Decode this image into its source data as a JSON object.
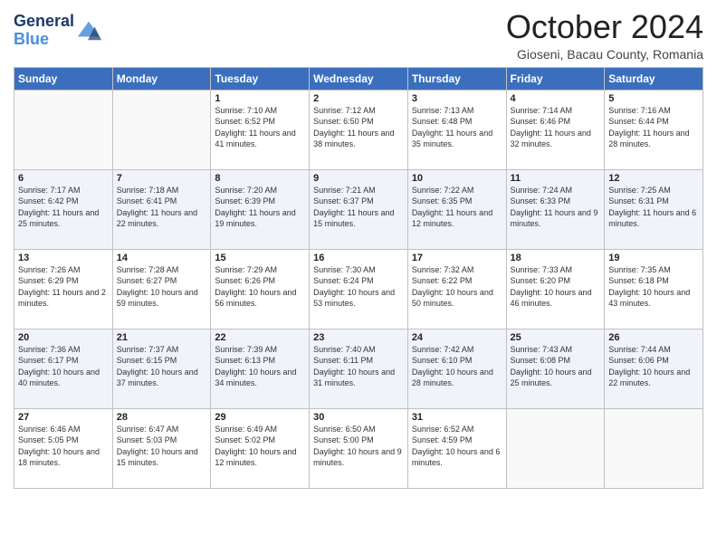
{
  "header": {
    "logo_line1": "General",
    "logo_line2": "Blue",
    "month": "October 2024",
    "location": "Gioseni, Bacau County, Romania"
  },
  "days_of_week": [
    "Sunday",
    "Monday",
    "Tuesday",
    "Wednesday",
    "Thursday",
    "Friday",
    "Saturday"
  ],
  "weeks": [
    [
      {
        "day": "",
        "info": ""
      },
      {
        "day": "",
        "info": ""
      },
      {
        "day": "1",
        "info": "Sunrise: 7:10 AM\nSunset: 6:52 PM\nDaylight: 11 hours and 41 minutes."
      },
      {
        "day": "2",
        "info": "Sunrise: 7:12 AM\nSunset: 6:50 PM\nDaylight: 11 hours and 38 minutes."
      },
      {
        "day": "3",
        "info": "Sunrise: 7:13 AM\nSunset: 6:48 PM\nDaylight: 11 hours and 35 minutes."
      },
      {
        "day": "4",
        "info": "Sunrise: 7:14 AM\nSunset: 6:46 PM\nDaylight: 11 hours and 32 minutes."
      },
      {
        "day": "5",
        "info": "Sunrise: 7:16 AM\nSunset: 6:44 PM\nDaylight: 11 hours and 28 minutes."
      }
    ],
    [
      {
        "day": "6",
        "info": "Sunrise: 7:17 AM\nSunset: 6:42 PM\nDaylight: 11 hours and 25 minutes."
      },
      {
        "day": "7",
        "info": "Sunrise: 7:18 AM\nSunset: 6:41 PM\nDaylight: 11 hours and 22 minutes."
      },
      {
        "day": "8",
        "info": "Sunrise: 7:20 AM\nSunset: 6:39 PM\nDaylight: 11 hours and 19 minutes."
      },
      {
        "day": "9",
        "info": "Sunrise: 7:21 AM\nSunset: 6:37 PM\nDaylight: 11 hours and 15 minutes."
      },
      {
        "day": "10",
        "info": "Sunrise: 7:22 AM\nSunset: 6:35 PM\nDaylight: 11 hours and 12 minutes."
      },
      {
        "day": "11",
        "info": "Sunrise: 7:24 AM\nSunset: 6:33 PM\nDaylight: 11 hours and 9 minutes."
      },
      {
        "day": "12",
        "info": "Sunrise: 7:25 AM\nSunset: 6:31 PM\nDaylight: 11 hours and 6 minutes."
      }
    ],
    [
      {
        "day": "13",
        "info": "Sunrise: 7:26 AM\nSunset: 6:29 PM\nDaylight: 11 hours and 2 minutes."
      },
      {
        "day": "14",
        "info": "Sunrise: 7:28 AM\nSunset: 6:27 PM\nDaylight: 10 hours and 59 minutes."
      },
      {
        "day": "15",
        "info": "Sunrise: 7:29 AM\nSunset: 6:26 PM\nDaylight: 10 hours and 56 minutes."
      },
      {
        "day": "16",
        "info": "Sunrise: 7:30 AM\nSunset: 6:24 PM\nDaylight: 10 hours and 53 minutes."
      },
      {
        "day": "17",
        "info": "Sunrise: 7:32 AM\nSunset: 6:22 PM\nDaylight: 10 hours and 50 minutes."
      },
      {
        "day": "18",
        "info": "Sunrise: 7:33 AM\nSunset: 6:20 PM\nDaylight: 10 hours and 46 minutes."
      },
      {
        "day": "19",
        "info": "Sunrise: 7:35 AM\nSunset: 6:18 PM\nDaylight: 10 hours and 43 minutes."
      }
    ],
    [
      {
        "day": "20",
        "info": "Sunrise: 7:36 AM\nSunset: 6:17 PM\nDaylight: 10 hours and 40 minutes."
      },
      {
        "day": "21",
        "info": "Sunrise: 7:37 AM\nSunset: 6:15 PM\nDaylight: 10 hours and 37 minutes."
      },
      {
        "day": "22",
        "info": "Sunrise: 7:39 AM\nSunset: 6:13 PM\nDaylight: 10 hours and 34 minutes."
      },
      {
        "day": "23",
        "info": "Sunrise: 7:40 AM\nSunset: 6:11 PM\nDaylight: 10 hours and 31 minutes."
      },
      {
        "day": "24",
        "info": "Sunrise: 7:42 AM\nSunset: 6:10 PM\nDaylight: 10 hours and 28 minutes."
      },
      {
        "day": "25",
        "info": "Sunrise: 7:43 AM\nSunset: 6:08 PM\nDaylight: 10 hours and 25 minutes."
      },
      {
        "day": "26",
        "info": "Sunrise: 7:44 AM\nSunset: 6:06 PM\nDaylight: 10 hours and 22 minutes."
      }
    ],
    [
      {
        "day": "27",
        "info": "Sunrise: 6:46 AM\nSunset: 5:05 PM\nDaylight: 10 hours and 18 minutes."
      },
      {
        "day": "28",
        "info": "Sunrise: 6:47 AM\nSunset: 5:03 PM\nDaylight: 10 hours and 15 minutes."
      },
      {
        "day": "29",
        "info": "Sunrise: 6:49 AM\nSunset: 5:02 PM\nDaylight: 10 hours and 12 minutes."
      },
      {
        "day": "30",
        "info": "Sunrise: 6:50 AM\nSunset: 5:00 PM\nDaylight: 10 hours and 9 minutes."
      },
      {
        "day": "31",
        "info": "Sunrise: 6:52 AM\nSunset: 4:59 PM\nDaylight: 10 hours and 6 minutes."
      },
      {
        "day": "",
        "info": ""
      },
      {
        "day": "",
        "info": ""
      }
    ]
  ]
}
